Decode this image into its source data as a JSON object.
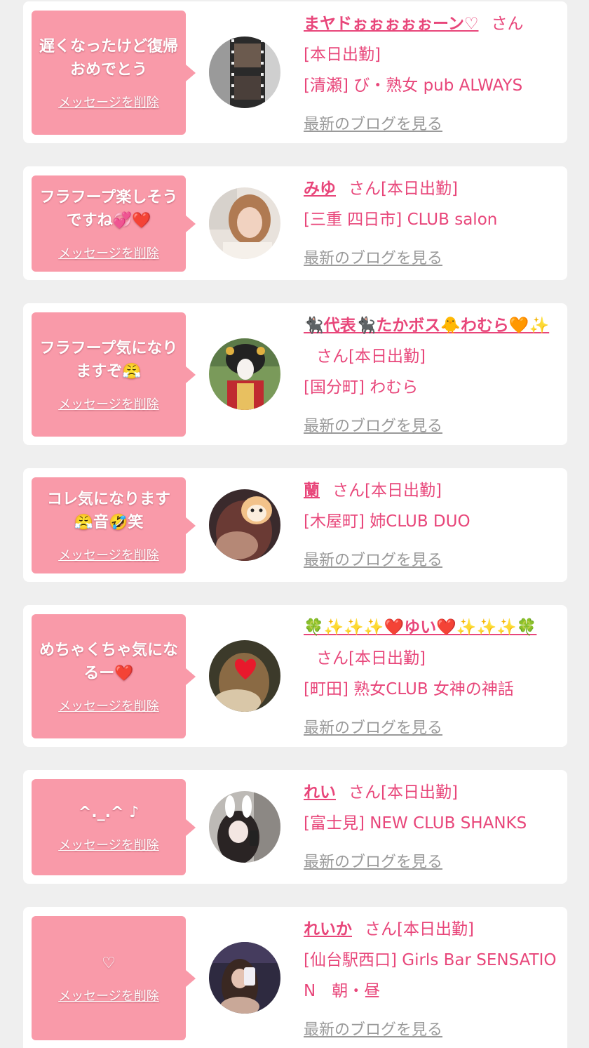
{
  "colors": {
    "background": "#efefef",
    "card": "#ffffff",
    "bubble": "#f99aa9",
    "accent_pink": "#e8467a",
    "muted_link": "#9a9a9a"
  },
  "messages": [
    {
      "bubble_text": "遅くなったけど復帰おめでとう",
      "delete_label": "メッセージを削除",
      "name": "まヤドぉぉぉぉぉーン♡",
      "honorific": "さん",
      "status": "[本日出勤]",
      "shop": "[清瀬] び・熟女 pub ALWAYS",
      "blog_label": "最新のブログを見る",
      "avatar_icon": "avatar-film-photo"
    },
    {
      "bubble_text": "フラフープ楽しそうですね💞❤️",
      "delete_label": "メッセージを削除",
      "name": "みゆ",
      "honorific": "さん",
      "status": "[本日出勤]",
      "shop": "[三重 四日市] CLUB salon",
      "blog_label": "最新のブログを見る",
      "avatar_icon": "avatar-woman-photo"
    },
    {
      "bubble_text": "フラフープ気になりますぞ😤",
      "delete_label": "メッセージを削除",
      "name": "🐈‍⬛代表🐈‍⬛たかボス🐥わむら🧡✨",
      "honorific": "さん",
      "status": "[本日出勤]",
      "shop": "[国分町] わむら",
      "blog_label": "最新のブログを見る",
      "avatar_icon": "avatar-geisha-photo"
    },
    {
      "bubble_text": "コレ気になります😤音🤣笑",
      "delete_label": "メッセージを削除",
      "name": "蘭",
      "honorific": "さん",
      "status": "[本日出勤]",
      "shop": "[木屋町] 姉CLUB DUO",
      "blog_label": "最新のブログを見る",
      "avatar_icon": "avatar-dog-face-photo"
    },
    {
      "bubble_text": "めちゃくちゃ気になるー❤️",
      "delete_label": "メッセージを削除",
      "name": "🍀✨✨✨❤️ゆい❤️✨✨✨🍀",
      "honorific": "さん",
      "status": "[本日出勤]",
      "shop": "[町田] 熟女CLUB 女神の神話",
      "blog_label": "最新のブログを見る",
      "avatar_icon": "avatar-heart-face-photo"
    },
    {
      "bubble_text": "^._.^ ♪",
      "delete_label": "メッセージを削除",
      "name": "れい",
      "honorific": "さん",
      "status": "[本日出勤]",
      "shop": "[富士見] NEW CLUB SHANKS",
      "blog_label": "最新のブログを見る",
      "avatar_icon": "avatar-bunny-ears-photo"
    },
    {
      "bubble_text": "♡",
      "delete_label": "メッセージを削除",
      "name": "れいか",
      "honorific": "さん",
      "status": "[本日出勤]",
      "shop": "[仙台駅西口] Girls Bar SENSATION　朝・昼",
      "blog_label": "最新のブログを見る",
      "avatar_icon": "avatar-mirror-selfie-photo"
    }
  ]
}
